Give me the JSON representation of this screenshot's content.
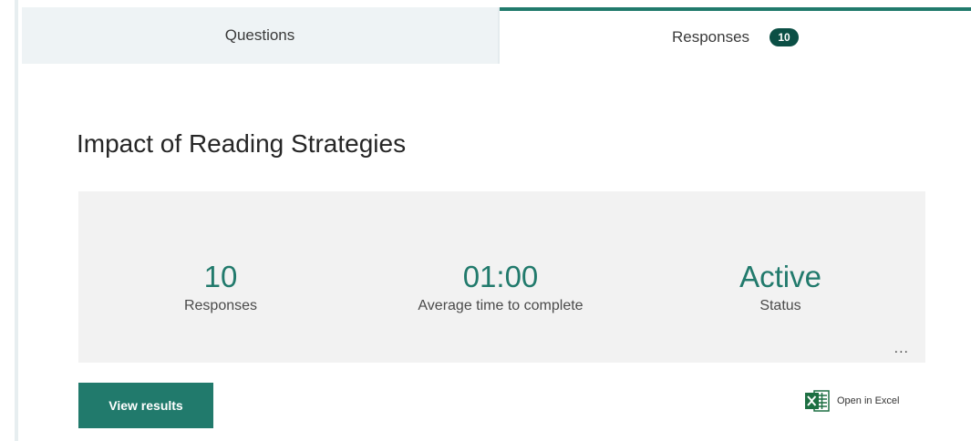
{
  "tabs": {
    "questions_label": "Questions",
    "responses_label": "Responses",
    "responses_count": "10"
  },
  "form": {
    "title": "Impact of Reading Strategies"
  },
  "summary": {
    "responses_value": "10",
    "responses_label": "Responses",
    "avg_time_value": "01:00",
    "avg_time_label": "Average time to complete",
    "status_value": "Active",
    "status_label": "Status",
    "more_label": "..."
  },
  "actions": {
    "view_results_label": "View results",
    "open_excel_label": "Open in Excel"
  },
  "icons": {
    "excel": "excel-icon"
  },
  "colors": {
    "accent": "#217a6c",
    "badge": "#0b4f45",
    "summary_bg": "#f2f2f2",
    "tab_inactive_bg": "#eef3f5"
  }
}
